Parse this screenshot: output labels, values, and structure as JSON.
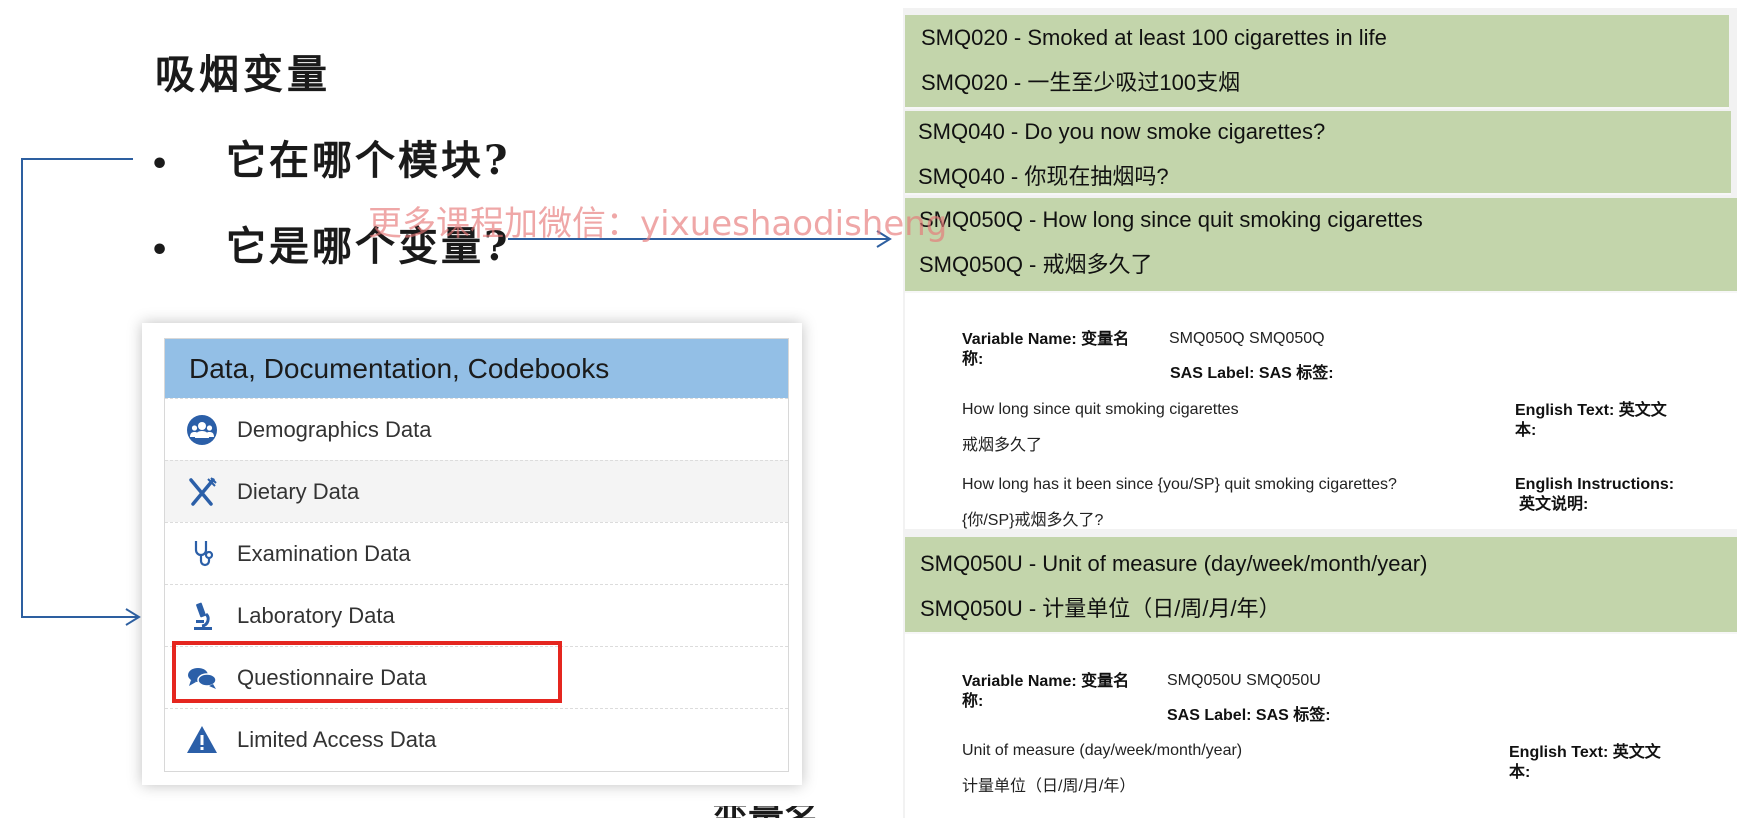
{
  "slide": {
    "title": "吸烟变量",
    "bullet_glyph": "•",
    "bullets": [
      "它在哪个模块?",
      "它是哪个变量?"
    ],
    "watermark": "更多课程加微信：yixueshaodisheng",
    "footer_fragment": "变量名"
  },
  "panel": {
    "header": "Data, Documentation, Codebooks",
    "items": [
      {
        "label": "Demographics Data",
        "icon": "people-group-icon"
      },
      {
        "label": "Dietary Data",
        "icon": "fork-knife-icon"
      },
      {
        "label": "Examination Data",
        "icon": "stethoscope-icon"
      },
      {
        "label": "Laboratory Data",
        "icon": "microscope-icon"
      },
      {
        "label": "Questionnaire Data",
        "icon": "chat-bubbles-icon"
      },
      {
        "label": "Limited Access Data",
        "icon": "warning-icon"
      }
    ],
    "highlight_color": "#e5261f",
    "header_color": "#93bfe6"
  },
  "codebook": {
    "header_color": "#c3d5ab",
    "variables": [
      {
        "en": "SMQ020 - Smoked at least 100 cigarettes in life",
        "zh": "SMQ020 - 一生至少吸过100支烟"
      },
      {
        "en": "SMQ040 - Do you now smoke cigarettes?",
        "zh": "SMQ040 - 你现在抽烟吗?"
      },
      {
        "en": "SMQ050Q - How long since quit smoking cigarettes",
        "zh": "SMQ050Q - 戒烟多久了"
      },
      {
        "en": "SMQ050U - Unit of measure (day/week/month/year)",
        "zh": "SMQ050U - 计量单位（日/周/月/年）"
      }
    ],
    "detail1": {
      "var_name_label": "Variable Name:  变量名",
      "var_name_label2": "称:",
      "var_name_value": "SMQ050Q SMQ050Q",
      "sas_label": "SAS Label:  SAS 标签:",
      "english_text_label": "English Text:  英文文",
      "english_text_label2": "本:",
      "text_en": "How long since quit smoking cigarettes",
      "text_zh": "戒烟多久了",
      "instr_label": "English Instructions:",
      "instr_label2": "英文说明:",
      "instr_en": "How long has it been since {you/SP} quit smoking cigarettes?",
      "instr_zh": "{你/SP}戒烟多久了?"
    },
    "detail2": {
      "var_name_label": "Variable Name:  变量名",
      "var_name_label2": "称:",
      "var_name_value": "SMQ050U SMQ050U",
      "sas_label": "SAS Label:  SAS 标签:",
      "english_text_label": "English Text:  英文文",
      "english_text_label2": "本:",
      "text_en": "Unit of measure (day/week/month/year)",
      "text_zh": "计量单位（日/周/月/年）"
    }
  }
}
